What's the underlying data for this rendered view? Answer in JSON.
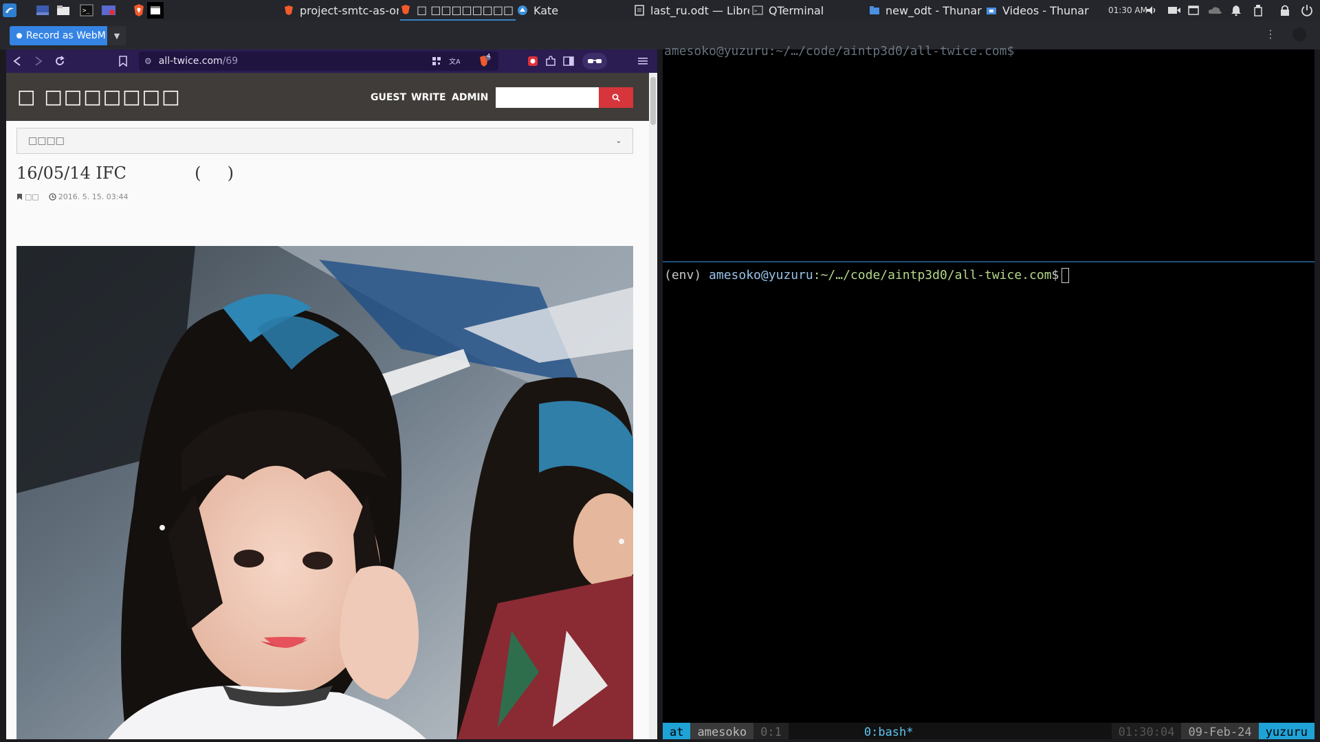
{
  "panel": {
    "tasks": [
      {
        "label": "project-smtc-as-or…"
      },
      {
        "label": "□ □□□□□□□□ …"
      },
      {
        "label": "Kate"
      },
      {
        "label": "last_ru.odt — Libre…"
      },
      {
        "label": "QTerminal"
      },
      {
        "label": "new_odt - Thunar"
      },
      {
        "label": "Videos - Thunar"
      }
    ],
    "clock": "01:30 AM"
  },
  "recorder": {
    "button_label": "Record as WebM"
  },
  "browser": {
    "url_host": "all-twice.com",
    "url_path": "/69",
    "badge_count": "4",
    "site": {
      "logo": "□ □□□□□□□",
      "nav": [
        "GUEST",
        "WRITE",
        "ADMIN"
      ],
      "search_placeholder": "",
      "category_select": "□□□□",
      "post_title": "16/05/14 IFC             (     )",
      "post_category": "□□",
      "post_date": "2016. 5. 15. 03:44"
    }
  },
  "terminal": {
    "top_line": "amesoko@yuzuru:~/…/code/aintp3d0/all-twice.com$",
    "prompt_env": "(env) ",
    "prompt_user": "amesoko@yuzuru",
    "prompt_path": ":~/…/code/aintp3d0/all-twice.com",
    "prompt_symbol": "$",
    "status": {
      "session": "at",
      "user": "amesoko",
      "pane": "0:1",
      "window": "0:bash*",
      "time": "01:30:04",
      "date": "09-Feb-24",
      "host": "yuzuru"
    }
  },
  "colors": {
    "browser_toolbar": "#2b1c52",
    "site_header": "#403c39",
    "search_button": "#d6353c",
    "recorder_button": "#3584e4",
    "tmux_accent": "#1fa3d6"
  }
}
